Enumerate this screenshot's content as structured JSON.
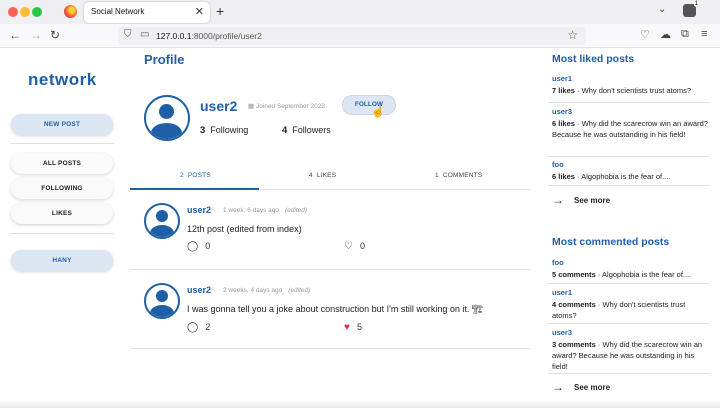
{
  "browser": {
    "tab_title": "Social Network",
    "url_host": "127.0.0.1",
    "url_path": ":8000/profile/user2",
    "badge_count": "1"
  },
  "sidebar": {
    "brand": "network",
    "new_post": "NEW POST",
    "all_posts": "ALL POSTS",
    "following": "FOLLOWING",
    "likes": "LIKES",
    "user": "HANY"
  },
  "profile": {
    "heading": "Profile",
    "username": "user2",
    "joined": "Joined September 2023",
    "follow_label": "FOLLOW",
    "following_count": "3",
    "following_label": "Following",
    "followers_count": "4",
    "followers_label": "Followers"
  },
  "tabs": [
    {
      "count": "2",
      "label": "POSTS"
    },
    {
      "count": "4",
      "label": "LIKES"
    },
    {
      "count": "1",
      "label": "COMMENTS"
    }
  ],
  "posts": [
    {
      "user": "user2",
      "time": "1 week, 6 days ago",
      "edited": "(edited)",
      "text": "12th post (edited from index)",
      "comments": "0",
      "likes": "0",
      "liked": false
    },
    {
      "user": "user2",
      "time": "2 weeks, 4 days ago",
      "edited": "(edited)",
      "text": "I was gonna tell you a joke about construction but I'm still working on it. 🏗",
      "comments": "2",
      "likes": "5",
      "liked": true
    }
  ],
  "most_liked": {
    "title": "Most liked posts",
    "items": [
      {
        "user": "user1",
        "count": "7 likes",
        "text": "Why don't scientists trust atoms?"
      },
      {
        "user": "user3",
        "count": "6 likes",
        "text": "Why did the scarecrow win an award? Because he was outstanding in his field!"
      },
      {
        "user": "foo",
        "count": "6 likes",
        "text": "Algophobia is the fear of...."
      }
    ],
    "see_more": "See more"
  },
  "most_commented": {
    "title": "Most commented posts",
    "items": [
      {
        "user": "foo",
        "count": "5 comments",
        "text": "Algophobia is the fear of...."
      },
      {
        "user": "user1",
        "count": "4 comments",
        "text": "Why don't scientists trust atoms?"
      },
      {
        "user": "user3",
        "count": "3 comments",
        "text": "Why did the scarecrow win an award? Because he was outstanding in his field!"
      }
    ],
    "see_more": "See more"
  },
  "colors": {
    "accent": "#1f5fa8",
    "liked": "#d8334a"
  }
}
